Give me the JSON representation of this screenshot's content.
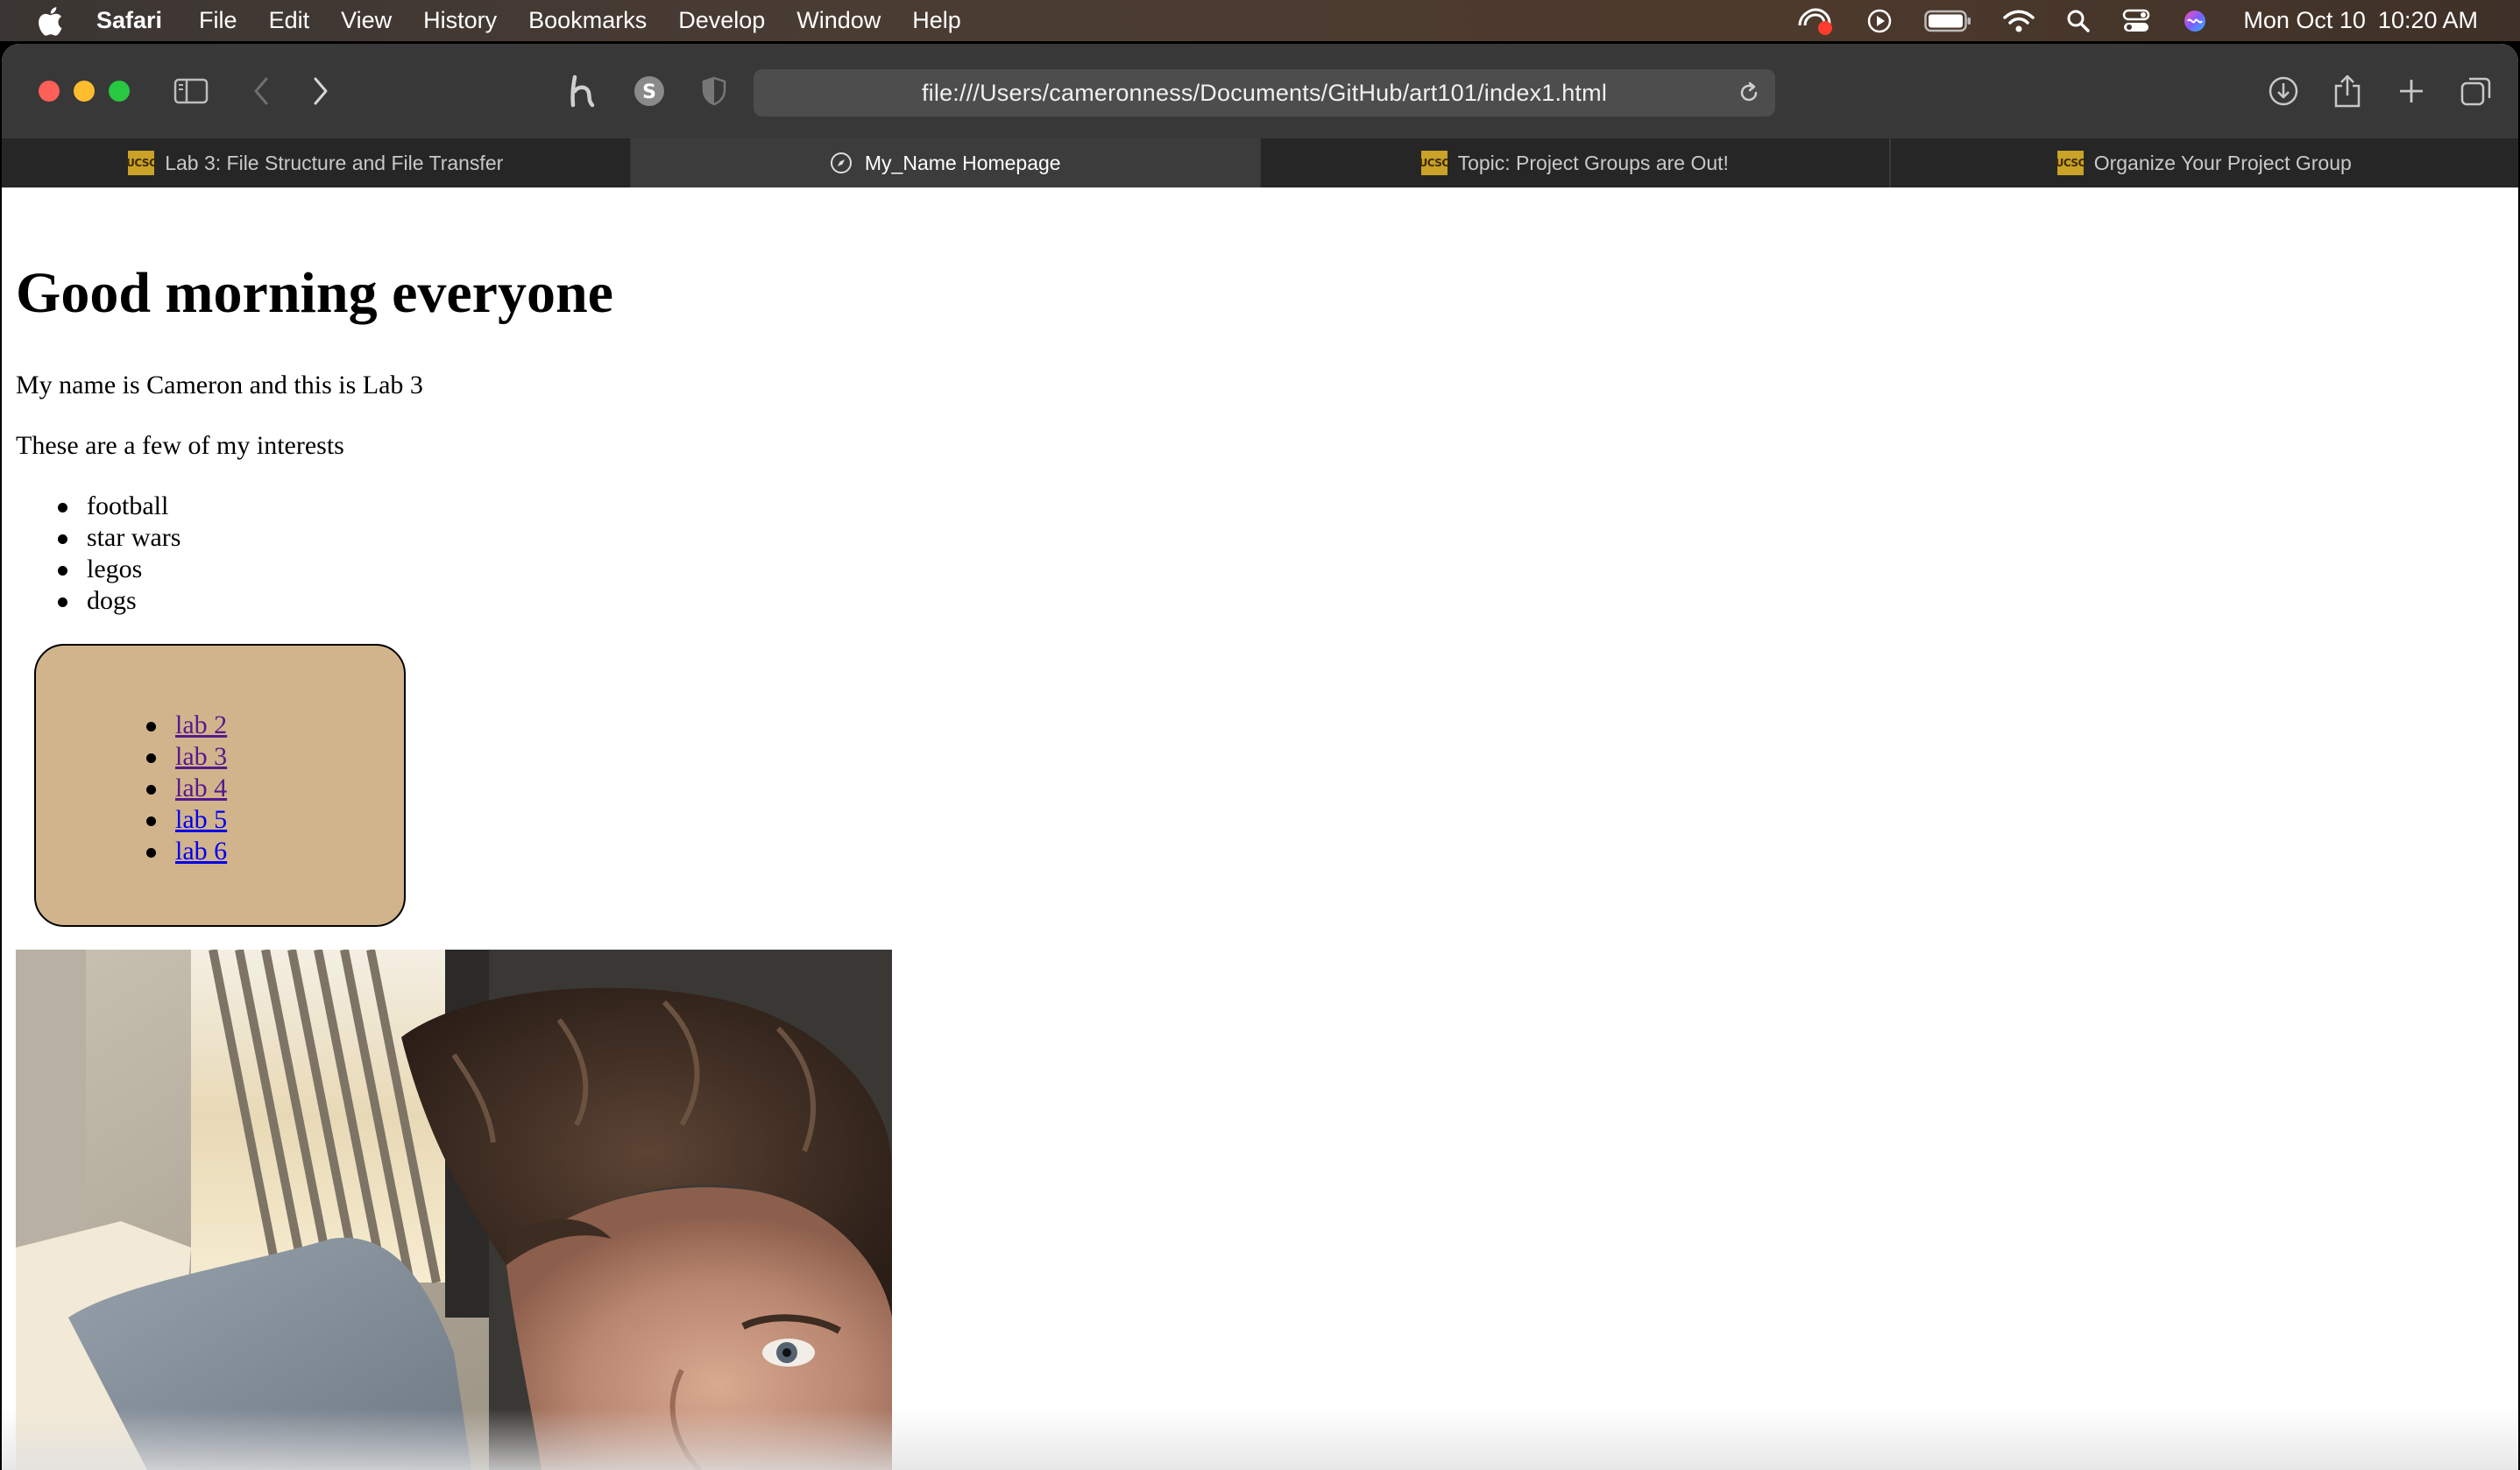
{
  "menubar": {
    "app_name": "Safari",
    "items": [
      "File",
      "Edit",
      "View",
      "History",
      "Bookmarks",
      "Develop",
      "Window",
      "Help"
    ],
    "clock": {
      "day_date": "Mon Oct 10",
      "time": "10:20 AM"
    },
    "status_icons": [
      "screen-recording-icon",
      "play-icon",
      "battery-icon",
      "wifi-icon",
      "spotlight-search-icon",
      "control-center-icon",
      "siri-icon"
    ]
  },
  "toolbar": {
    "url": "file:///Users/cameronness/Documents/GitHub/art101/index1.html",
    "icons": [
      "sidebar-icon",
      "back-chevron-icon",
      "forward-chevron-icon",
      "honey-extension-icon",
      "s-extension-icon",
      "privacy-shield-icon",
      "reload-icon",
      "download-icon",
      "share-icon",
      "plus-icon",
      "tab-overview-icon"
    ]
  },
  "tabs": [
    {
      "label": "Lab 3: File Structure and File Transfer",
      "favicon": "UCSC",
      "active": false
    },
    {
      "label": "My_Name Homepage",
      "favicon": "compass",
      "active": true
    },
    {
      "label": "Topic: Project Groups are Out!",
      "favicon": "UCSC",
      "active": false
    },
    {
      "label": "Organize Your Project Group",
      "favicon": "UCSC",
      "active": false
    }
  ],
  "page": {
    "heading": "Good morning everyone",
    "intro": "My name is Cameron and this is Lab 3",
    "interests_intro": "These are a few of my interests",
    "interests": [
      "football",
      "star wars",
      "legos",
      "dogs"
    ],
    "nav_box_color": "#d2b48c",
    "nav_links": [
      {
        "label": "lab 2",
        "visited": true
      },
      {
        "label": "lab 3",
        "visited": true
      },
      {
        "label": "lab 4",
        "visited": true
      },
      {
        "label": "lab 5",
        "visited": false
      },
      {
        "label": "lab 6",
        "visited": false
      }
    ]
  },
  "colors": {
    "link_visited": "#551a8b",
    "link_unvisited": "#0000ee",
    "toolbar_bg": "#383838",
    "tabbar_bg": "#262626",
    "active_tab_bg": "#3c3c3c"
  }
}
